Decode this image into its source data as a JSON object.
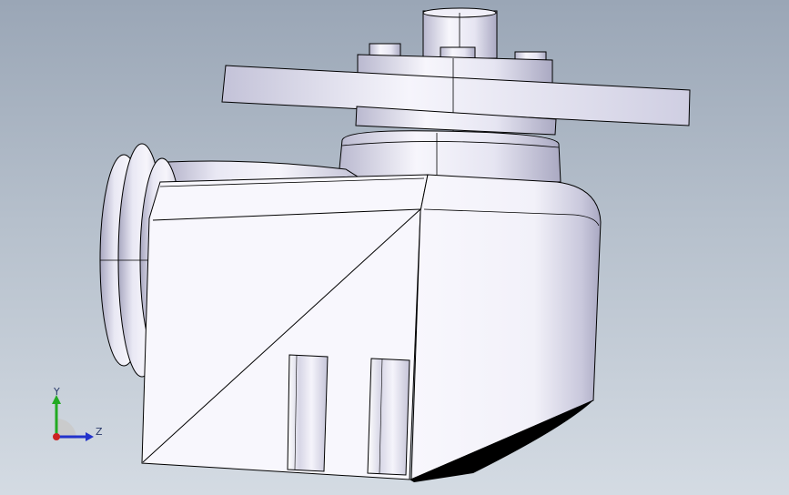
{
  "viewport": {
    "background_top": "#9aa6b6",
    "background_bottom": "#d4dbe3"
  },
  "model": {
    "body_color": "#f4f3fa",
    "shade_color": "#c7c6d8",
    "edge_color": "#000000"
  },
  "triad": {
    "x_label": "",
    "y_label": "Y",
    "z_label": "Z",
    "y_color": "#22aa22",
    "z_color": "#2233cc",
    "x_color": "#cc2222"
  }
}
